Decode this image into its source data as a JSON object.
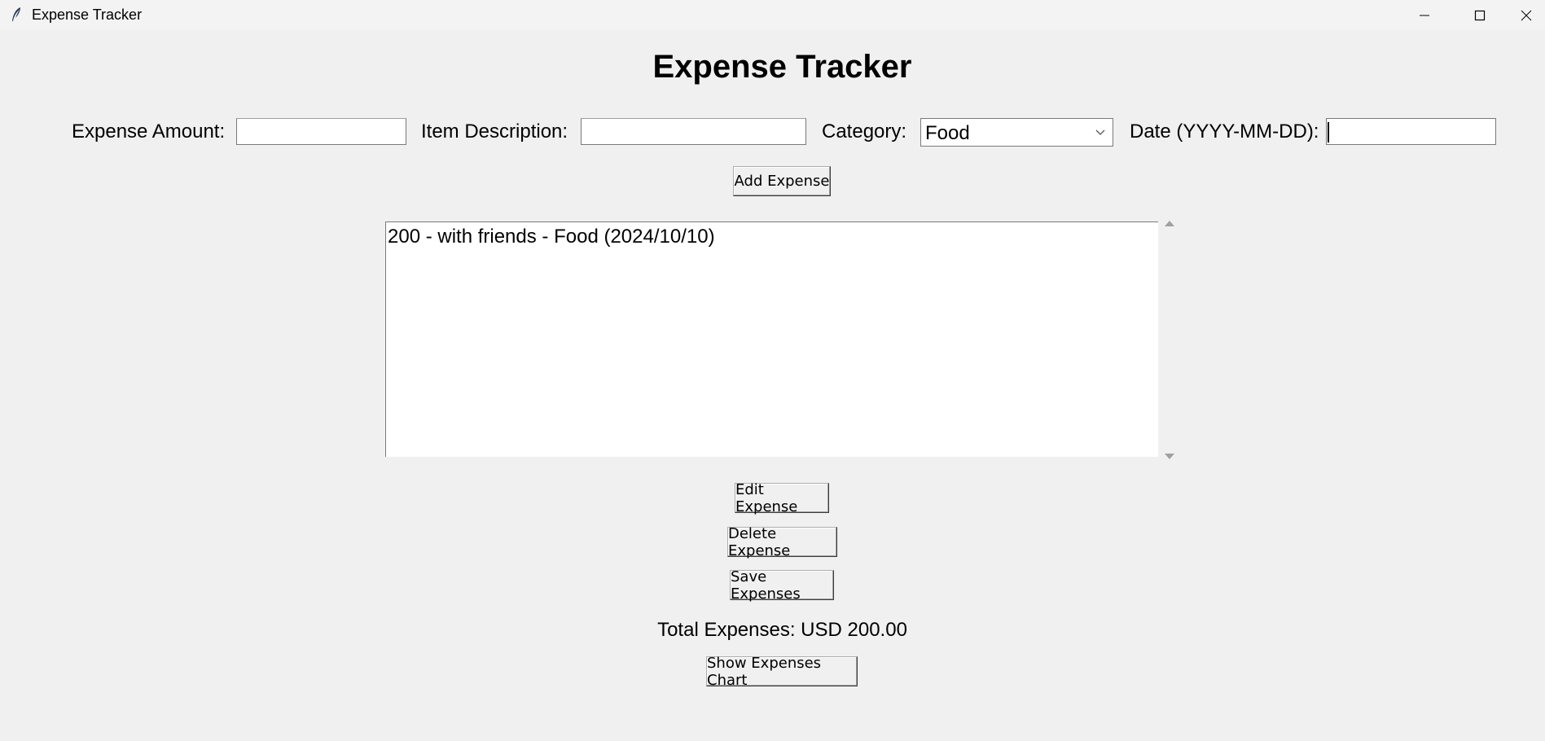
{
  "window": {
    "title": "Expense Tracker",
    "icon": "feather-icon"
  },
  "header": {
    "title": "Expense Tracker"
  },
  "form": {
    "amount_label": "Expense Amount:",
    "amount_value": "",
    "description_label": "Item Description:",
    "description_value": "",
    "category_label": "Category:",
    "category_value": "Food",
    "date_label": "Date (YYYY-MM-DD):",
    "date_value": "",
    "add_button": "Add Expense"
  },
  "expenses": {
    "items": [
      "200 - with friends - Food (2024/10/10)"
    ]
  },
  "actions": {
    "edit_button": "Edit Expense",
    "delete_button": "Delete Expense",
    "save_button": "Save Expenses",
    "chart_button": "Show Expenses Chart"
  },
  "summary": {
    "total_text": "Total Expenses: USD 200.00"
  }
}
